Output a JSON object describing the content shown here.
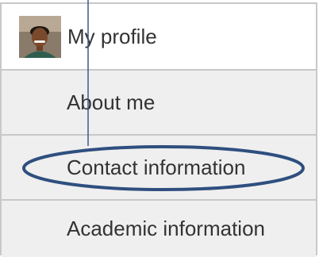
{
  "menu": {
    "profile": {
      "avatar_icon": "user-avatar-photo",
      "label": "My profile"
    },
    "items": [
      {
        "label": "About me"
      },
      {
        "label": "Contact information"
      },
      {
        "label": "Academic information"
      }
    ]
  },
  "annotation": {
    "highlight_color": "#2e4f7f",
    "pointer_color": "#3a5a8c"
  }
}
